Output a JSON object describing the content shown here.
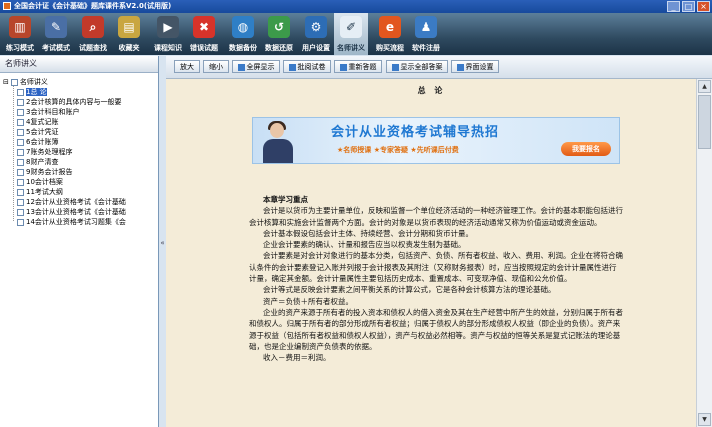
{
  "window": {
    "title": "全国会计证《会计基础》题库课件系V2.0(试用版)",
    "buttons": [
      "_",
      "□",
      "×"
    ]
  },
  "toolbar": [
    {
      "label": "练习模式",
      "icon": "books-icon",
      "color": "#b8462b"
    },
    {
      "label": "考试模式",
      "icon": "exam-paper-icon",
      "color": "#4a6fa5"
    },
    {
      "label": "试题查找",
      "icon": "search-icon",
      "color": "#c23a2a"
    },
    {
      "label": "收藏夹",
      "icon": "folder-icon",
      "color": "#c9a640"
    },
    {
      "label": "课程知识",
      "icon": "video-icon",
      "color": "#445566"
    },
    {
      "label": "错误试题",
      "icon": "error-icon",
      "color": "#d7332a"
    },
    {
      "label": "数据备份",
      "icon": "globe-icon",
      "color": "#2f7fc6"
    },
    {
      "label": "数据还原",
      "icon": "restore-icon",
      "color": "#3c9a4a"
    },
    {
      "label": "用户设置",
      "icon": "user-settings-icon",
      "color": "#2d6db5"
    },
    {
      "label": "名师讲义",
      "icon": "notes-icon",
      "color": "#e6eef5",
      "active": true
    },
    {
      "label": "购买流程",
      "icon": "browser-e-icon",
      "color": "#e2561e"
    },
    {
      "label": "软件注册",
      "icon": "register-icon",
      "color": "#3b7bc4"
    }
  ],
  "left_panel": {
    "header": "名师讲义",
    "root": "名师讲义",
    "items": [
      {
        "label": "1总  论",
        "selected": true
      },
      {
        "label": "2会计核算的具体内容与一般要"
      },
      {
        "label": "3会计科目和账户"
      },
      {
        "label": "4复式记账"
      },
      {
        "label": "5会计凭证"
      },
      {
        "label": "6会计账簿"
      },
      {
        "label": "7账务处理程序"
      },
      {
        "label": "8财产清查"
      },
      {
        "label": "9财务会计报告"
      },
      {
        "label": "10会计档案"
      },
      {
        "label": "11考试大纲"
      },
      {
        "label": "12会计从业资格考试《会计基础"
      },
      {
        "label": "13会计从业资格考试《会计基础"
      },
      {
        "label": "14会计从业资格考试习题集《会"
      }
    ]
  },
  "content_toolbar": [
    {
      "label": "放大",
      "icon": false
    },
    {
      "label": "缩小",
      "icon": false
    },
    {
      "label": "全屏显示",
      "icon": true
    },
    {
      "label": "批阅试卷",
      "icon": true
    },
    {
      "label": "重新答题",
      "icon": true
    },
    {
      "label": "显示全部答案",
      "icon": true
    },
    {
      "label": "界面设置",
      "icon": true
    }
  ],
  "document": {
    "title": "总  论",
    "banner": {
      "title": "会计从业资格考试辅导热招",
      "subtitle": "★名师授课 ★专家答疑 ★先听课后付费",
      "button": "我要报名"
    },
    "section_heading": "本章学习重点",
    "paragraphs": [
      "会计是以货币为主要计量单位，反映和监督一个单位经济活动的一种经济管理工作。会计的基本职能包括进行会计核算和实施会计监督两个方面。会计的对象是以货币表现的经济活动通常又称为价值运动或资金运动。",
      "会计基本假设包括会计主体、持续经营、会计分期和货币计量。",
      "企业会计要素的确认、计量和报告应当以权责发生制为基础。",
      "会计要素是对会计对象进行的基本分类，包括资产、负债、所有者权益、收入、费用、利润。企业在将符合确认条件的会计要素登记入账并列报于会计报表及其附注（又称财务报表）时，应当按照规定的会计计量属性进行计量，确定其金额。会计计量属性主要包括历史成本、重置成本、可变现净值、现值和公允价值。",
      "会计等式是反映会计要素之间平衡关系的计算公式，它是各种会计核算方法的理论基础。",
      "资产＝负债＋所有者权益。",
      "企业的资产来源于所有者的投入资本和债权人的借入资金及其在生产经营中所产生的效益，分别归属于所有者和债权人。归属于所有者的部分形成所有者权益；归属于债权人的部分形成债权人权益（即企业的负债）。资产来源于权益（包括所有者权益和债权人权益），资产与权益必然相等。资产与权益的恒等关系是复式记账法的理论基础，也是企业编制资产负债表的依据。",
      "收入－费用＝利润。"
    ]
  }
}
